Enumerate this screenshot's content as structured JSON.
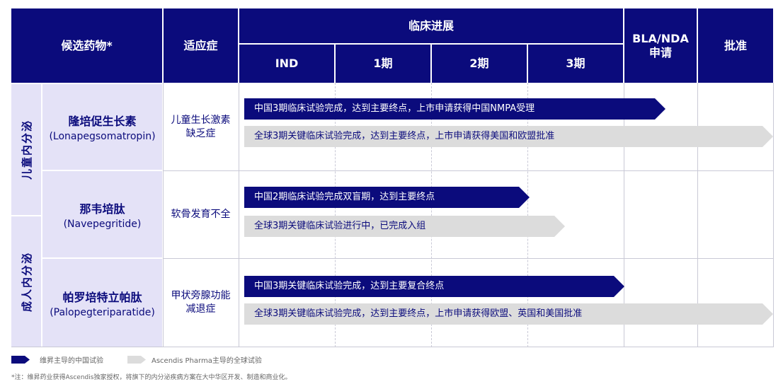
{
  "header": {
    "candidate": "候选药物*",
    "indication": "适应症",
    "clinical_progress": "临床进展",
    "phases": [
      "IND",
      "1期",
      "2期",
      "3期"
    ],
    "bla_nda": "BLA/NDA\n申请",
    "approval": "批准"
  },
  "categories": [
    "儿童内分泌",
    "成人内分泌"
  ],
  "rows": [
    {
      "drug_cn": "隆培促生长素",
      "drug_en": "(Lonapegsomatropin)",
      "indication": "儿童生长激素\n缺乏症",
      "china_bar": "中国3期临床试验完成，达到主要终点，上市申请获得中国NMPA受理",
      "global_bar": "全球3期关键临床试验完成，达到主要终点，上市申请获得美国和欧盟批准"
    },
    {
      "drug_cn": "那韦培肽",
      "drug_en": "(Navepegritide)",
      "indication": "软骨发育不全",
      "china_bar": "中国2期临床试验完成双盲期，达到主要终点",
      "global_bar": "全球3期关键临床试验进行中，已完成入组"
    },
    {
      "drug_cn": "帕罗培特立帕肽",
      "drug_en": "(Palopegteriparatide)",
      "indication": "甲状旁腺功能\n减退症",
      "china_bar": "中国3期关键临床试验完成，达到主要复合终点",
      "global_bar": "全球3期关键临床试验完成，达到主要终点，上市申请获得欧盟、英国和美国批准"
    }
  ],
  "legend": {
    "china": "维昇主导的中国试验",
    "global": "Ascendis Pharma主导的全球试验"
  },
  "footnote": "*注：维昇药业获得Ascendis独家授权，将旗下的内分泌疾病方案在大中华区开发、制造和商业化。",
  "colors": {
    "dark": "#0b0b7c",
    "gray": "#dcdcdc",
    "side": "#e4e2f7"
  }
}
